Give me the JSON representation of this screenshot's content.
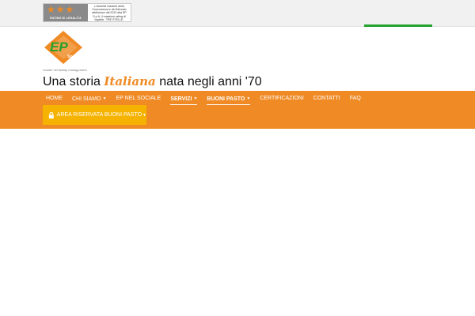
{
  "top_bar": {
    "rating_badge": {
      "seal_label": "RATING DI LEGALITÀ",
      "stars": 3,
      "note": "L'Autorità Garante della Concorrenza e del Mercato attribuisce dal 2013 alla EP S.p.A. il massimo rating di legalità : TRE STELLE."
    },
    "accent_color": "#23a12e"
  },
  "header": {
    "logo": {
      "text": "EP",
      "subtext": "Spa",
      "caption": "Leader nel facility management",
      "colors": {
        "orange": "#f08a24",
        "green": "#23a12e"
      }
    },
    "tagline": {
      "before": "Una storia ",
      "accent": "Italiana",
      "after": " nata negli anni '70"
    }
  },
  "nav": {
    "background": "#f08a24",
    "items": [
      {
        "label": "HOME",
        "dropdown": false,
        "bold": false
      },
      {
        "label": "CHI SIAMO",
        "dropdown": true,
        "bold": false
      },
      {
        "label": "EP NEL SOCIALE",
        "dropdown": false,
        "bold": false
      },
      {
        "label": "SERVIZI",
        "dropdown": true,
        "bold": true
      },
      {
        "label": "BUONI PASTO",
        "dropdown": true,
        "bold": true
      },
      {
        "label": "CERTIFICAZIONI",
        "dropdown": false,
        "bold": false
      },
      {
        "label": "CONTATTI",
        "dropdown": false,
        "bold": false
      },
      {
        "label": "FAQ",
        "dropdown": false,
        "bold": false
      }
    ],
    "reserved_area": {
      "label": "AREA RISERVATA BUONI PASTO",
      "icon": "lock-icon",
      "color": "#f5b300"
    }
  }
}
